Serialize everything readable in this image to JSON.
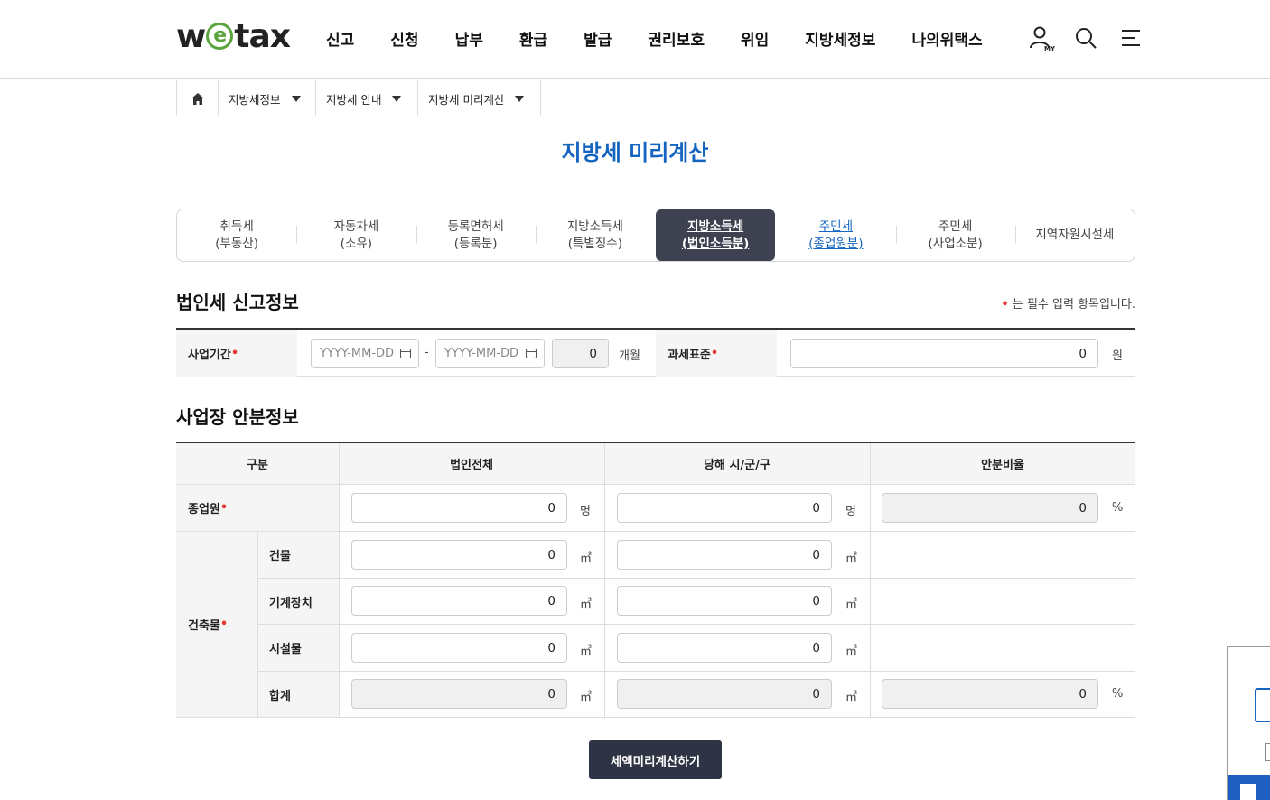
{
  "header": {
    "logo": "wetax",
    "nav": [
      "신고",
      "신청",
      "납부",
      "환급",
      "발급",
      "권리보호",
      "위임",
      "지방세정보",
      "나의위택스"
    ],
    "icons": [
      "my-user-icon",
      "search-icon",
      "menu-icon"
    ],
    "my_label": "MY"
  },
  "breadcrumb": [
    "지방세정보",
    "지방세 안내",
    "지방세 미리계산"
  ],
  "title": "지방세 미리계산",
  "tabs": [
    {
      "label": "취득세\n(부동산)",
      "state": "normal"
    },
    {
      "label": "자동차세\n(소유)",
      "state": "normal"
    },
    {
      "label": "등록면허세\n(등록분)",
      "state": "normal"
    },
    {
      "label": "지방소득세\n(특별징수)",
      "state": "normal"
    },
    {
      "label": "지방소득세\n(법인소득분)",
      "state": "active"
    },
    {
      "label": "주민세\n(종업원분)",
      "state": "link"
    },
    {
      "label": "주민세\n(사업소분)",
      "state": "normal"
    },
    {
      "label": "지역자원시설세",
      "state": "normal"
    }
  ],
  "section1": {
    "title": "법인세 신고정보",
    "required_note": "는 필수 입력 항목입니다.",
    "period_label": "사업기간",
    "date_placeholder": "YYYY-MM-DD",
    "dash": "-",
    "months_value": "0",
    "months_unit": "개월",
    "tax_base_label": "과세표준",
    "tax_base_value": "0",
    "tax_base_unit": "원"
  },
  "section2": {
    "title": "사업장 안분정보",
    "headers": [
      "구분",
      "법인전체",
      "당해 시/군/구",
      "안분비율"
    ],
    "employee_label": "종업원",
    "building_label": "건축물",
    "sub_rows": [
      "건물",
      "기계장치",
      "시설물",
      "합계"
    ],
    "unit_person": "명",
    "unit_area": "㎡",
    "unit_percent": "%",
    "zero": "0"
  },
  "button": "세액미리계산하기",
  "colors": {
    "accent": "#1565c0",
    "active_tab": "#3d4150",
    "required": "#e53935",
    "button": "#2e3444"
  }
}
